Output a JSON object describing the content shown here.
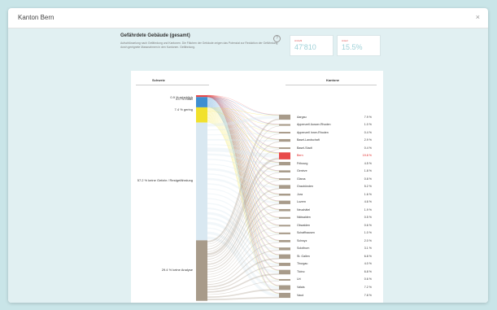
{
  "window": {
    "title": "Kanton Bern",
    "close_label": "×"
  },
  "header": {
    "title": "Gefährdete Gebäude (gesamt)",
    "description": "Aufschlüsselung nach Gefährdung und Kantonen. Die Flächen der Gebäude zeigen das Potenzial zur Reduktion der Gefährdung durch geeignete Massnahmen in den Kantonen. Gefährdung.",
    "info_label": "?"
  },
  "stats": [
    {
      "label": "Anzahl",
      "value": "47'810"
    },
    {
      "label": "Anteil",
      "value": "15.5%"
    }
  ],
  "columns": {
    "left": "Schweiz",
    "right": "Kantone"
  },
  "categories": [
    {
      "label": "0.9 % erheblich",
      "color": "#e84a4a",
      "share": 0.009
    },
    {
      "label": "5.0 % mittel",
      "color": "#3f8fd0",
      "share": 0.05
    },
    {
      "label": "7.4 % gering",
      "color": "#f1e12c",
      "share": 0.074
    },
    {
      "label": "57.2 % keine Gefahr / Restgefährdung",
      "color": "#d9e8f1",
      "share": 0.572
    },
    {
      "label": "29.4 % keine Analyse",
      "color": "#a89b8a",
      "share": 0.294
    }
  ],
  "cantons": [
    {
      "name": "Aargau",
      "pct": "7.9 %",
      "highlight": false
    },
    {
      "name": "Appenzell Ausser-Rhoden",
      "pct": "1.0 %",
      "highlight": false
    },
    {
      "name": "Appenzell Inner-Rhoden",
      "pct": "0.4 %",
      "highlight": false
    },
    {
      "name": "Basel-Landschaft",
      "pct": "2.9 %",
      "highlight": false
    },
    {
      "name": "Basel-Stadt",
      "pct": "0.4 %",
      "highlight": false
    },
    {
      "name": "Bern",
      "pct": "19.8 %",
      "highlight": true
    },
    {
      "name": "Fribourg",
      "pct": "4.5 %",
      "highlight": false
    },
    {
      "name": "Genève",
      "pct": "1.8 %",
      "highlight": false
    },
    {
      "name": "Glarus",
      "pct": "0.8 %",
      "highlight": false
    },
    {
      "name": "Graubünden",
      "pct": "5.2 %",
      "highlight": false
    },
    {
      "name": "Jura",
      "pct": "1.6 %",
      "highlight": false
    },
    {
      "name": "Luzern",
      "pct": "4.6 %",
      "highlight": false
    },
    {
      "name": "Neuchâtel",
      "pct": "1.9 %",
      "highlight": false
    },
    {
      "name": "Nidwalden",
      "pct": "0.5 %",
      "highlight": false
    },
    {
      "name": "Obwalden",
      "pct": "0.6 %",
      "highlight": false
    },
    {
      "name": "Schaffhausen",
      "pct": "1.0 %",
      "highlight": false
    },
    {
      "name": "Schwyz",
      "pct": "2.0 %",
      "highlight": false
    },
    {
      "name": "Solothurn",
      "pct": "3.1 %",
      "highlight": false
    },
    {
      "name": "St. Gallen",
      "pct": "6.8 %",
      "highlight": false
    },
    {
      "name": "Thurgau",
      "pct": "4.0 %",
      "highlight": false
    },
    {
      "name": "Ticino",
      "pct": "6.8 %",
      "highlight": false
    },
    {
      "name": "Uri",
      "pct": "0.6 %",
      "highlight": false
    },
    {
      "name": "Valais",
      "pct": "7.2 %",
      "highlight": false
    },
    {
      "name": "Vaud",
      "pct": "7.8 %",
      "highlight": false
    }
  ]
}
